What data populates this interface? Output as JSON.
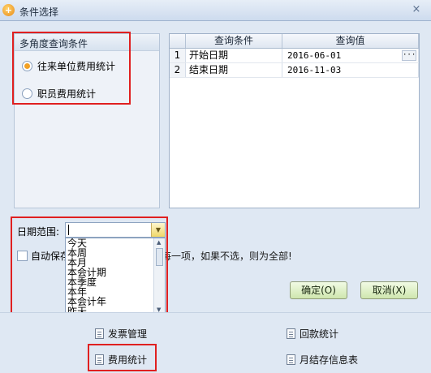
{
  "window": {
    "title": "条件选择",
    "close_glyph": "×",
    "app_icon": "app-logo-icon"
  },
  "conditions_group": {
    "title": "多角度查询条件",
    "options": [
      {
        "label": "往来单位费用统计",
        "checked": true
      },
      {
        "label": "职员费用统计",
        "checked": false
      }
    ]
  },
  "query_grid": {
    "columns": [
      "查询条件",
      "查询值"
    ],
    "rows": [
      {
        "index": "1",
        "condition": "开始日期",
        "value": "2016-06-01",
        "has_ellipsis": true
      },
      {
        "index": "2",
        "condition": "结束日期",
        "value": "2016-11-03",
        "has_ellipsis": false
      }
    ],
    "ellipsis_label": "···"
  },
  "date_range": {
    "label": "日期范围:",
    "value": "",
    "options": [
      "今天",
      "本周",
      "本月",
      "本会计期",
      "本季度",
      "本年",
      "本会计年",
      "昨天"
    ]
  },
  "auto_save": {
    "label": "自动保存",
    "checked": false
  },
  "hint_text": "对每一项，如果不选，则为全部!",
  "buttons": {
    "ok": "确定(O)",
    "cancel": "取消(X)"
  },
  "nav_links": [
    "发票管理",
    "回款统计",
    "费用统计",
    "月结存信息表"
  ],
  "colors": {
    "accent_highlight": "#e02020",
    "radio_checked": "#f2a125",
    "button_green": "#cfe6ae"
  }
}
